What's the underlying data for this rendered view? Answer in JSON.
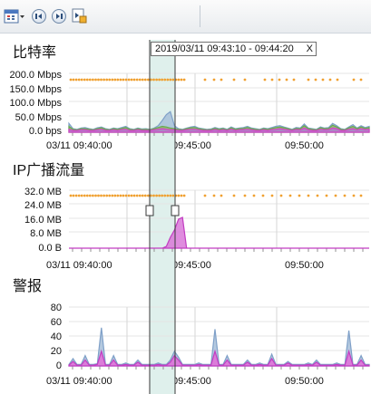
{
  "toolbar": {
    "icons": [
      "calendar-dropdown-icon",
      "first-icon",
      "next-icon",
      "last-icon"
    ]
  },
  "selection": {
    "label": "2019/03/11  09:43:10 - 09:44:20",
    "close": "X"
  },
  "sections": [
    {
      "title": "比特率",
      "y_labels": [
        "200.0 Mbps",
        "150.0 Mbps",
        "100.0 Mbps",
        "50.0 Mbps",
        "0.0 bps"
      ]
    },
    {
      "title": "IP广播流量",
      "y_labels": [
        "32.0 MB",
        "24.0 MB",
        "16.0 MB",
        "8.0 MB",
        "0.0 B"
      ]
    },
    {
      "title": "警报",
      "y_labels": [
        "80",
        "60",
        "40",
        "20",
        "0"
      ]
    }
  ],
  "x_labels": [
    "03/11 09:40:00",
    "09:45:00",
    "09:50:00"
  ],
  "colors": {
    "dots": "#f0a030",
    "area_blue": "#a7bfd9",
    "magenta": "#d640c8",
    "green": "#6aa84f",
    "selection_fill": "#dff0ec"
  },
  "chart_data": [
    {
      "type": "area",
      "title": "比特率",
      "x_range": [
        "09:38:00",
        "09:53:40"
      ],
      "ylim": [
        0,
        200
      ],
      "unit": "Mbps",
      "series": [
        {
          "values": [
            30,
            12,
            10,
            14,
            16,
            12,
            10,
            15,
            18,
            12,
            10,
            14,
            12,
            16,
            20,
            12,
            10,
            14,
            11,
            12,
            10,
            14,
            22,
            40,
            60,
            70,
            22,
            12,
            10,
            14,
            18,
            20,
            14,
            12,
            10,
            11,
            16,
            12,
            14,
            10,
            18,
            12,
            14,
            16,
            20,
            14,
            12,
            10,
            14,
            12,
            16,
            20,
            22,
            18,
            14,
            10,
            16,
            14,
            28,
            14,
            12,
            10,
            18,
            14,
            16,
            30,
            22,
            12,
            10,
            18,
            26,
            14,
            22,
            16,
            20
          ]
        },
        {
          "values": [
            20,
            10,
            8,
            12,
            12,
            10,
            8,
            12,
            15,
            10,
            8,
            12,
            10,
            13,
            16,
            10,
            8,
            12,
            9,
            10,
            8,
            12,
            16,
            20,
            18,
            14,
            12,
            10,
            8,
            12,
            15,
            16,
            12,
            10,
            8,
            9,
            13,
            10,
            12,
            8,
            15,
            10,
            12,
            13,
            16,
            12,
            10,
            8,
            12,
            10,
            13,
            16,
            18,
            15,
            12,
            8,
            13,
            12,
            22,
            12,
            10,
            8,
            15,
            12,
            13,
            24,
            18,
            10,
            8,
            15,
            20,
            12,
            18,
            13,
            16
          ]
        },
        {
          "values": [
            10,
            6,
            6,
            8,
            8,
            6,
            6,
            8,
            10,
            6,
            6,
            8,
            6,
            9,
            10,
            6,
            6,
            8,
            6,
            6,
            6,
            8,
            10,
            12,
            10,
            8,
            8,
            6,
            6,
            8,
            10,
            10,
            8,
            6,
            6,
            6,
            9,
            6,
            8,
            6,
            10,
            6,
            8,
            9,
            10,
            8,
            6,
            6,
            8,
            6,
            9,
            10,
            12,
            10,
            8,
            6,
            9,
            8,
            14,
            8,
            6,
            6,
            10,
            8,
            9,
            14,
            12,
            6,
            6,
            10,
            12,
            8,
            12,
            9,
            10
          ]
        }
      ]
    },
    {
      "type": "area",
      "title": "IP广播流量",
      "x_range": [
        "09:38:00",
        "09:53:40"
      ],
      "ylim": [
        0,
        32
      ],
      "unit": "MB",
      "series": [
        {
          "values": [
            0,
            0,
            0,
            0,
            0,
            0,
            0,
            0,
            0,
            0,
            0,
            0,
            0,
            0,
            0,
            0,
            0,
            0,
            0,
            0,
            0,
            0,
            0,
            0,
            1,
            6,
            10,
            16,
            17,
            0,
            0,
            0,
            0,
            0,
            0,
            0,
            0,
            0,
            0,
            0,
            0,
            0,
            0,
            0,
            0,
            0,
            0,
            0,
            0,
            0,
            0,
            0,
            0,
            0,
            0,
            0,
            0,
            0,
            0,
            0,
            0,
            0,
            0,
            0,
            0,
            0,
            0,
            0,
            0,
            0,
            0,
            0,
            0,
            0,
            0
          ]
        }
      ]
    },
    {
      "type": "area",
      "title": "警报",
      "x_range": [
        "09:38:00",
        "09:53:40"
      ],
      "ylim": [
        0,
        80
      ],
      "series": [
        {
          "values": [
            2,
            10,
            2,
            2,
            14,
            2,
            2,
            3,
            52,
            2,
            2,
            14,
            2,
            2,
            4,
            2,
            2,
            8,
            2,
            2,
            2,
            2,
            4,
            2,
            2,
            8,
            20,
            12,
            2,
            2,
            2,
            2,
            4,
            2,
            2,
            2,
            50,
            2,
            2,
            14,
            2,
            2,
            2,
            2,
            8,
            2,
            2,
            4,
            2,
            2,
            16,
            2,
            2,
            2,
            6,
            2,
            2,
            2,
            2,
            4,
            2,
            8,
            2,
            2,
            2,
            2,
            4,
            2,
            2,
            48,
            2,
            2,
            14,
            2,
            2
          ]
        },
        {
          "values": [
            1,
            6,
            1,
            1,
            8,
            1,
            1,
            2,
            20,
            1,
            1,
            8,
            1,
            1,
            2,
            1,
            1,
            5,
            1,
            1,
            1,
            1,
            2,
            1,
            1,
            5,
            14,
            8,
            1,
            1,
            1,
            1,
            2,
            1,
            1,
            1,
            20,
            1,
            1,
            8,
            1,
            1,
            1,
            1,
            5,
            1,
            1,
            2,
            1,
            1,
            10,
            1,
            1,
            1,
            4,
            1,
            1,
            1,
            1,
            2,
            1,
            5,
            1,
            1,
            1,
            1,
            2,
            1,
            1,
            20,
            1,
            1,
            8,
            1,
            1
          ]
        }
      ]
    }
  ]
}
